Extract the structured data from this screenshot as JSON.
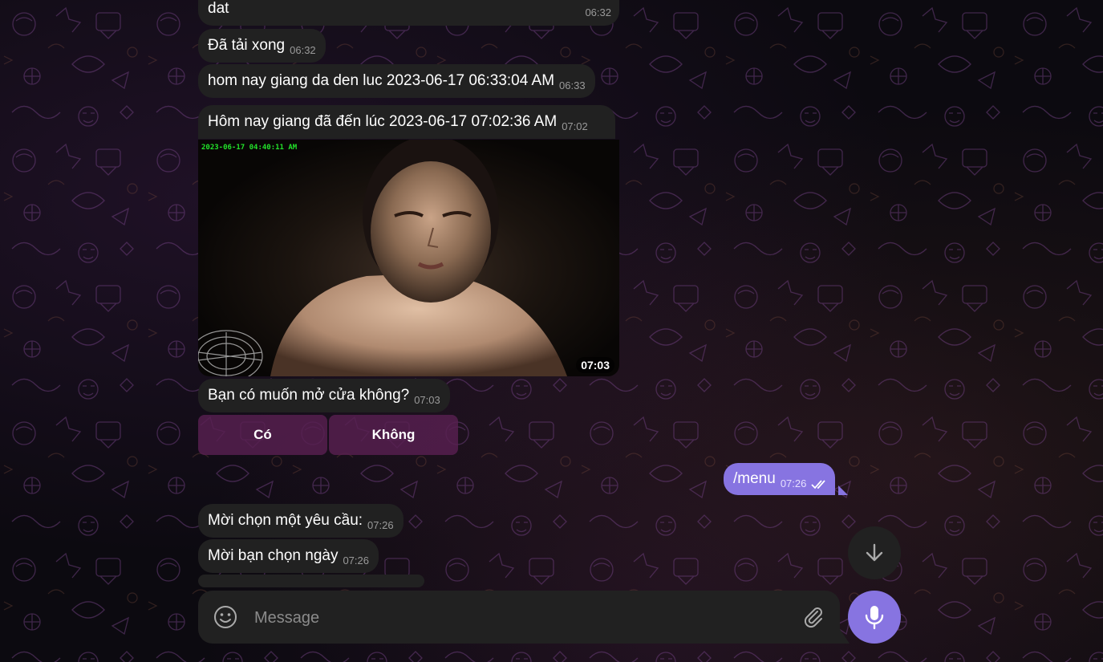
{
  "messages": {
    "m1": {
      "text": "dat",
      "time": "06:32"
    },
    "m2": {
      "text": "Đã tải xong",
      "time": "06:32"
    },
    "m3": {
      "text": "hom nay giang da den luc 2023-06-17 06:33:04 AM",
      "time": "06:33"
    },
    "m4": {
      "text": "Hôm nay giang đã đến lúc 2023-06-17 07:02:36 AM",
      "time": "07:02"
    },
    "photo": {
      "timestamp_overlay": "2023-06-17 04:40:11 AM",
      "time": "07:03"
    },
    "m5": {
      "text": "Bạn có muốn mở cửa không?",
      "time": "07:03"
    },
    "out1": {
      "text": "/menu",
      "time": "07:26",
      "status": "read"
    },
    "m6": {
      "text": "Mời chọn một yêu cầu:",
      "time": "07:26"
    },
    "m7": {
      "text": "Mời bạn chọn ngày",
      "time": "07:26"
    }
  },
  "inline_keyboard": {
    "yes": "Có",
    "no": "Không"
  },
  "composer": {
    "placeholder": "Message"
  },
  "icons": {
    "emoji": "smile-icon",
    "attach": "paperclip-icon",
    "mic": "microphone-icon",
    "scroll": "arrow-down-icon",
    "read": "double-check-icon"
  },
  "colors": {
    "accent": "#8774e1",
    "bubble_in": "#212121",
    "timestamp_green": "#22e22a",
    "keyboard_button": "#582050"
  }
}
